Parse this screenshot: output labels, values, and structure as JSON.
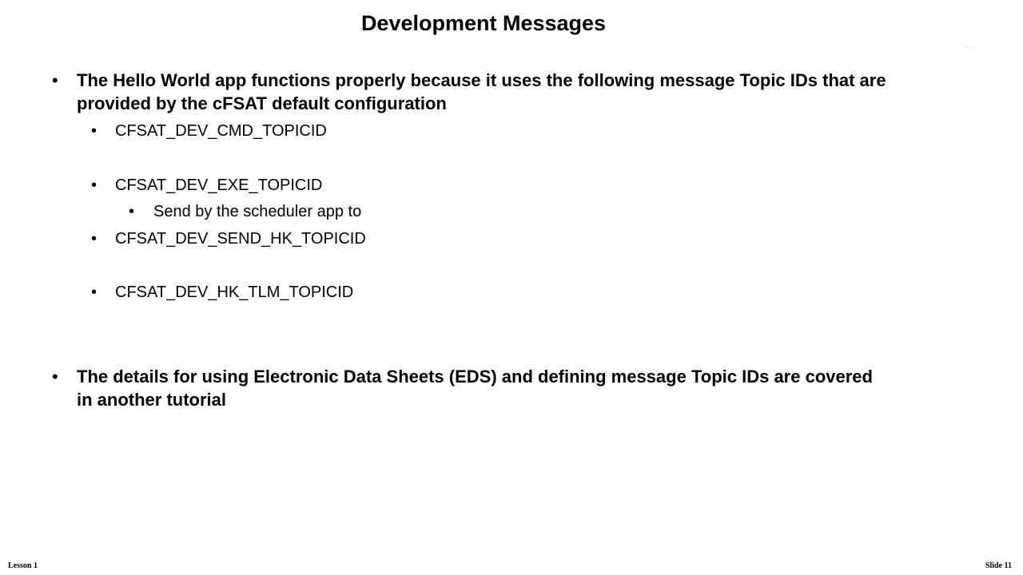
{
  "slide": {
    "title": "Development Messages",
    "bullets": [
      {
        "text": "The Hello World app functions properly because it uses the following message Topic IDs that are provided by the cFSAT default configuration",
        "sub": [
          {
            "text": "CFSAT_DEV_CMD_TOPICID"
          },
          {
            "text": "CFSAT_DEV_EXE_TOPICID",
            "sub": [
              {
                "text": "Send by the scheduler app to"
              }
            ]
          },
          {
            "text": "CFSAT_DEV_SEND_HK_TOPICID"
          },
          {
            "text": "CFSAT_DEV_HK_TLM_TOPICID"
          }
        ]
      },
      {
        "text": "The details for using Electronic Data Sheets (EDS) and defining message Topic IDs are covered in another tutorial"
      }
    ],
    "bullet_symbol": "•"
  },
  "footer": {
    "left": "Lesson 1",
    "right": "Slide 11"
  }
}
